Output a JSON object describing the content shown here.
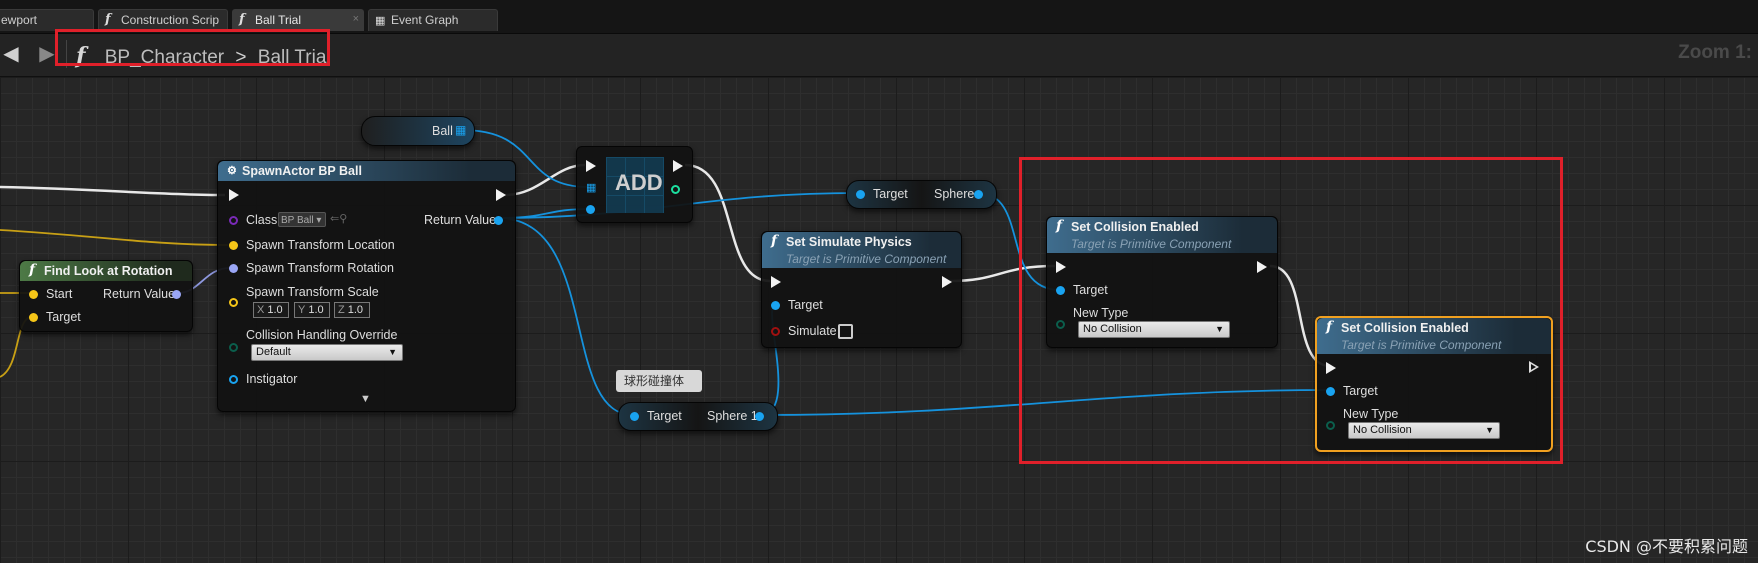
{
  "tabs": [
    {
      "label": "ewport",
      "icon": "viewport-icon"
    },
    {
      "label": "Construction Scrip",
      "icon": "function-icon"
    },
    {
      "label": "Ball Trial",
      "icon": "function-icon"
    },
    {
      "label": "Event Graph",
      "icon": "event-graph-icon"
    }
  ],
  "breadcrumb": {
    "parent": "BP_Character",
    "separator": ">",
    "current": "Ball Trial"
  },
  "zoom_label": "Zoom 1:",
  "nodes": {
    "ball_var": {
      "label": "Ball"
    },
    "spawn": {
      "title": "SpawnActor BP Ball",
      "class_label": "Class",
      "class_value": "BP Ball",
      "loc_label": "Spawn Transform Location",
      "rot_label": "Spawn Transform Rotation",
      "scale_label": "Spawn Transform Scale",
      "scale_x": "1.0",
      "scale_y": "1.0",
      "scale_z": "1.0",
      "axis_x": "X",
      "axis_y": "Y",
      "axis_z": "Z",
      "collision_label": "Collision Handling Override",
      "collision_value": "Default",
      "instigator_label": "Instigator",
      "return_label": "Return Value"
    },
    "find_look": {
      "title": "Find Look at Rotation",
      "start_label": "Start",
      "target_label": "Target",
      "return_label": "Return Value"
    },
    "add": {
      "label": "ADD"
    },
    "get_sphere": {
      "target_label": "Target",
      "out_label": "Sphere"
    },
    "get_sphere1": {
      "target_label": "Target",
      "out_label": "Sphere 1",
      "tooltip": "球形碰撞体"
    },
    "simulate": {
      "title": "Set Simulate Physics",
      "subtitle": "Target is Primitive Component",
      "target_label": "Target",
      "simulate_label": "Simulate"
    },
    "collision1": {
      "title": "Set Collision Enabled",
      "subtitle": "Target is Primitive Component",
      "target_label": "Target",
      "newtype_label": "New Type",
      "newtype_value": "No Collision"
    },
    "collision2": {
      "title": "Set Collision Enabled",
      "subtitle": "Target is Primitive Component",
      "target_label": "Target",
      "newtype_label": "New Type",
      "newtype_value": "No Collision"
    }
  },
  "colors": {
    "exec": "#ffffff",
    "object": "#19a3f0",
    "vector": "#f5c518",
    "rotator": "#9aa6f5",
    "class": "#7a2ab8",
    "bool": "#8b0c0c",
    "enum": "#0b5e4c",
    "highlight": "#e0202a",
    "selected": "#f0a020"
  },
  "watermark": "CSDN @不要积累问题"
}
